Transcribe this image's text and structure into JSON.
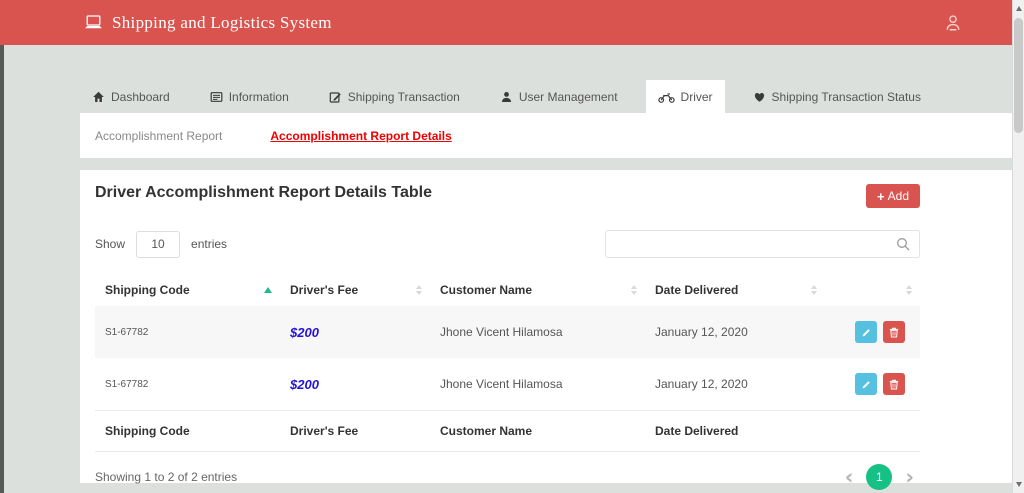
{
  "header": {
    "title": "Shipping and Logistics System"
  },
  "nav": {
    "tabs": [
      {
        "label": "Dashboard",
        "icon": "home-icon",
        "active": false
      },
      {
        "label": "Information",
        "icon": "info-card-icon",
        "active": false
      },
      {
        "label": "Shipping Transaction",
        "icon": "edit-square-icon",
        "active": false
      },
      {
        "label": "User Management",
        "icon": "user-icon",
        "active": false
      },
      {
        "label": "Driver",
        "icon": "motorcycle-icon",
        "active": true
      },
      {
        "label": "Shipping Transaction Status",
        "icon": "heart-icon",
        "active": false
      }
    ]
  },
  "subnav": {
    "items": [
      {
        "label": "Accomplishment Report",
        "active": false
      },
      {
        "label": "Accomplishment Report Details",
        "active": true
      }
    ]
  },
  "panel": {
    "title": "Driver Accomplishment Report Details Table",
    "add_button_label": "Add",
    "show_entries": {
      "label_before": "Show",
      "value": "10",
      "label_after": "entries"
    },
    "search": {
      "value": "",
      "placeholder": ""
    },
    "table": {
      "columns": [
        {
          "label": "Shipping Code",
          "sort": "asc"
        },
        {
          "label": "Driver's Fee",
          "sort": "none"
        },
        {
          "label": "Customer Name",
          "sort": "none"
        },
        {
          "label": "Date Delivered",
          "sort": "none"
        },
        {
          "label": "",
          "sort": "none"
        }
      ],
      "rows": [
        {
          "shipping_code": "S1-67782",
          "drivers_fee": "$200",
          "customer_name": "Jhone Vicent Hilamosa",
          "date_delivered": "January 12, 2020"
        },
        {
          "shipping_code": "S1-67782",
          "drivers_fee": "$200",
          "customer_name": "Jhone Vicent Hilamosa",
          "date_delivered": "January 12, 2020"
        }
      ],
      "footer_columns": [
        "Shipping Code",
        "Driver's Fee",
        "Customer Name",
        "Date Delivered",
        ""
      ]
    },
    "summary": "Showing 1 to 2 of 2 entries",
    "pagination": {
      "page": "1"
    }
  },
  "glyphs": {
    "plus": "+",
    "chevron_left": "‹",
    "chevron_right": "›"
  },
  "icons": {
    "topbar_left": "laptop-icon",
    "topbar_right": "user-profile-icon",
    "search": "search-icon",
    "row_edit": "pencil-icon",
    "row_delete": "trash-icon",
    "sorted_column": "sort-asc-icon",
    "unsorted_column": "sort-both-icon"
  },
  "colors": {
    "header_red": "#d9534f",
    "active_link_red": "#ee0000",
    "fee_blue": "#2213d6",
    "edit_blue": "#56c0e0",
    "delete_red": "#d9534f",
    "pagination_green": "#17c186",
    "sort_green": "#1dbc8c",
    "page_background": "#dce0dc"
  }
}
